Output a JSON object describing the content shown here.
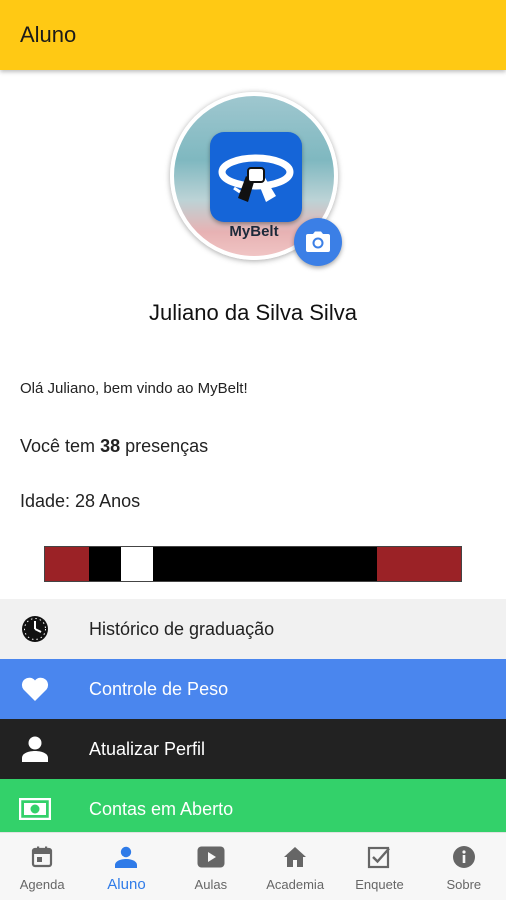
{
  "appbar": {
    "title": "Aluno",
    "color": "#FFC914"
  },
  "profile": {
    "logo_text": "MyBelt",
    "name": "Juliano da Silva Silva",
    "greeting": "Olá Juliano, bem vindo ao MyBelt!",
    "presencas_prefix": "Você tem",
    "presencas_count": "38",
    "presencas_suffix": "presenças",
    "idade": "Idade: 28 Anos"
  },
  "belt": {
    "main_color": "#000000",
    "end_color": "#9b2226",
    "stripe_color": "#ffffff",
    "stripes": 1
  },
  "menu": {
    "historico": "Histórico de graduação",
    "peso": "Controle de Peso",
    "perfil": "Atualizar Perfil",
    "contas": "Contas em Aberto"
  },
  "nav": {
    "agenda": "Agenda",
    "aluno": "Aluno",
    "aulas": "Aulas",
    "academia": "Academia",
    "enquete": "Enquete",
    "sobre": "Sobre",
    "active_color": "#2f7be8"
  },
  "icons": {
    "camera": "camera-icon",
    "history": "clock-icon",
    "weight": "heart-icon",
    "profile": "person-icon",
    "bills": "money-icon"
  }
}
